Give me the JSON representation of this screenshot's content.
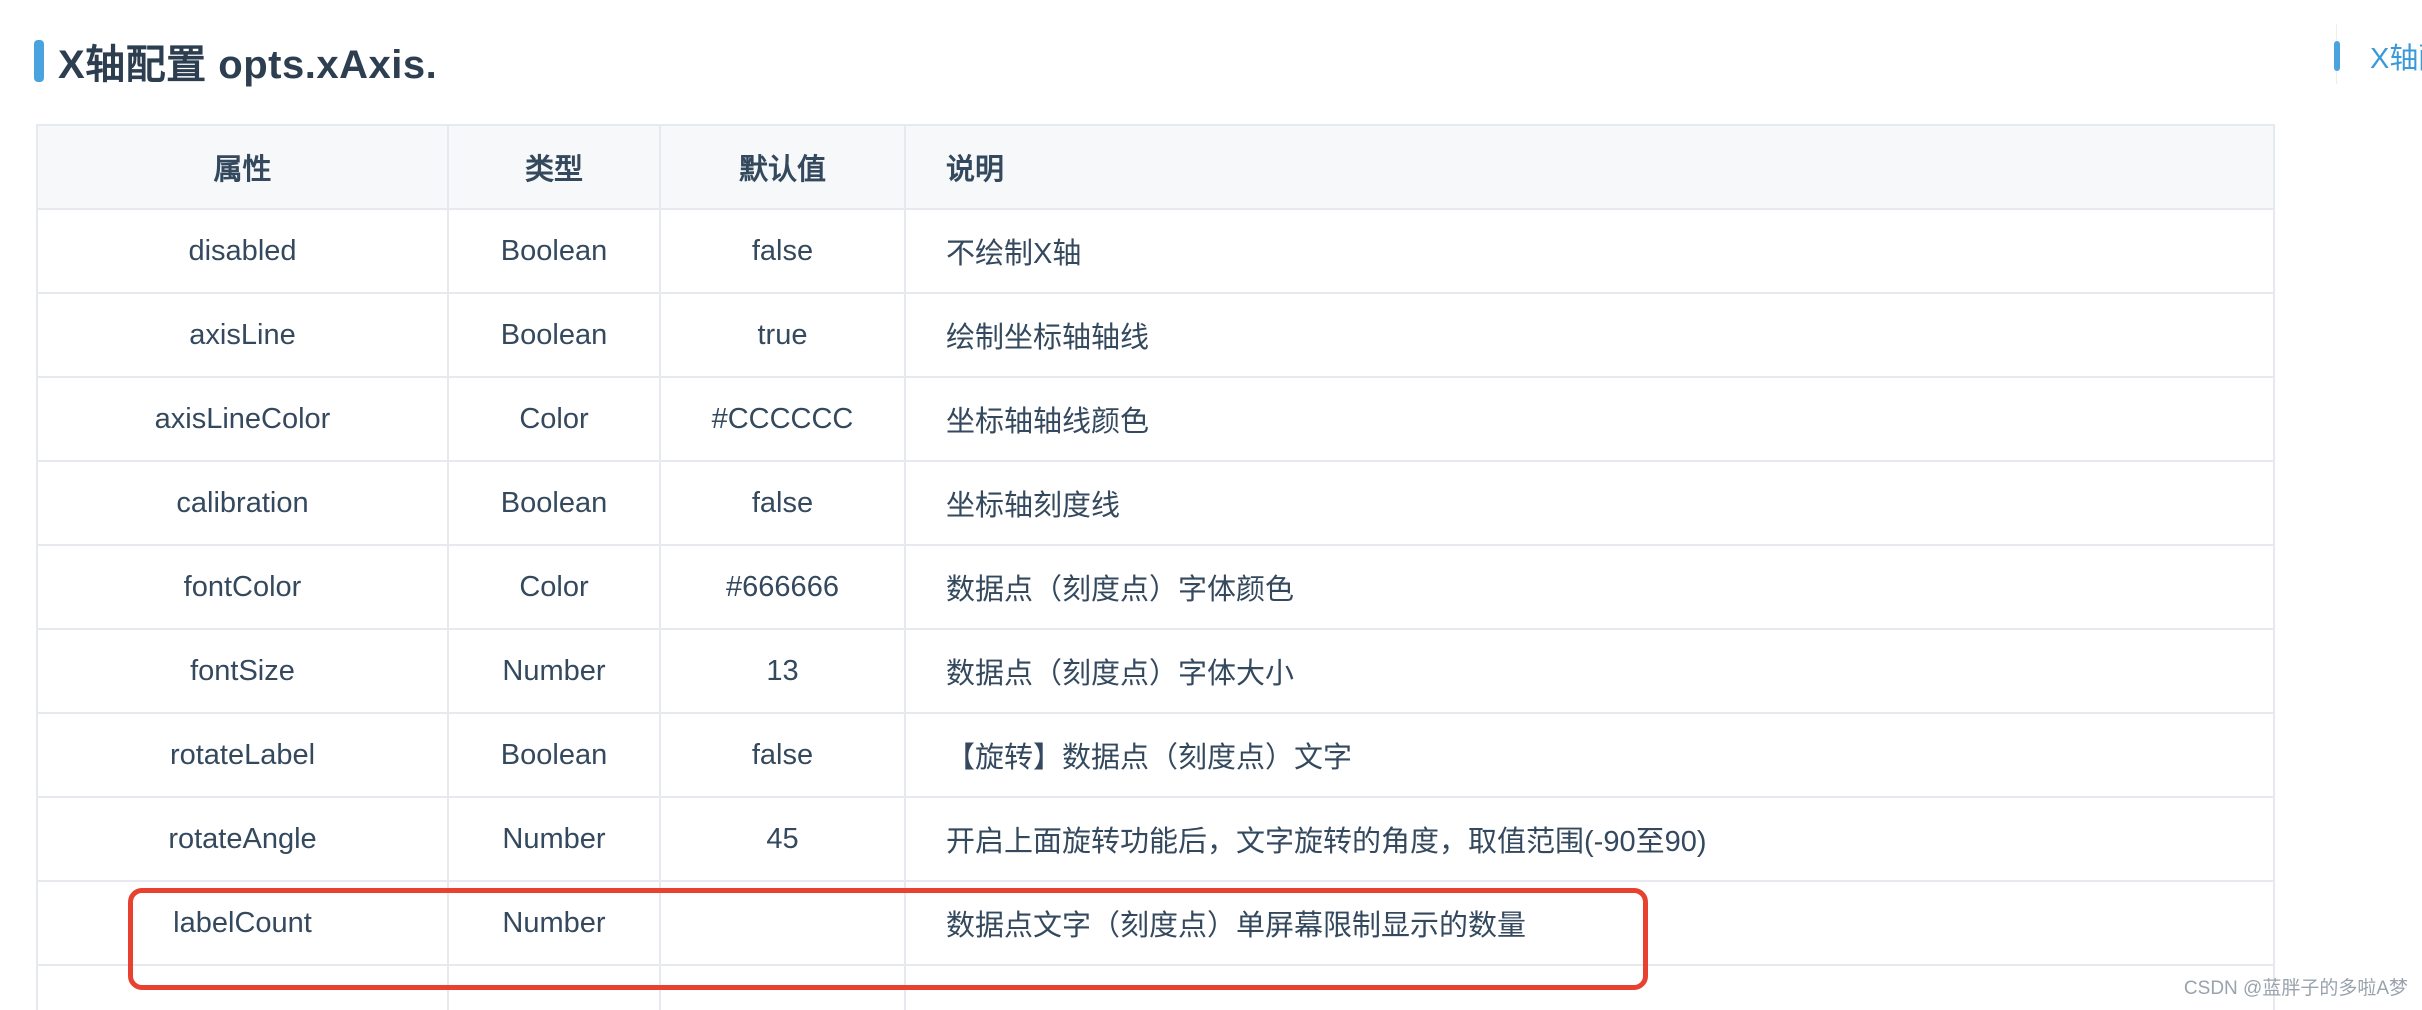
{
  "section": {
    "title": "X轴配置 opts.xAxis."
  },
  "toc": {
    "link_label": "X轴配置"
  },
  "table": {
    "headers": [
      "属性",
      "类型",
      "默认值",
      "说明"
    ],
    "rows": [
      [
        "disabled",
        "Boolean",
        "false",
        "不绘制X轴"
      ],
      [
        "axisLine",
        "Boolean",
        "true",
        "绘制坐标轴轴线"
      ],
      [
        "axisLineColor",
        "Color",
        "#CCCCCC",
        "坐标轴轴线颜色"
      ],
      [
        "calibration",
        "Boolean",
        "false",
        "坐标轴刻度线"
      ],
      [
        "fontColor",
        "Color",
        "#666666",
        "数据点（刻度点）字体颜色"
      ],
      [
        "fontSize",
        "Number",
        "13",
        "数据点（刻度点）字体大小"
      ],
      [
        "rotateLabel",
        "Boolean",
        "false",
        "【旋转】数据点（刻度点）文字"
      ],
      [
        "rotateAngle",
        "Number",
        "45",
        "开启上面旋转功能后，文字旋转的角度，取值范围(-90至90)"
      ],
      [
        "labelCount",
        "Number",
        "",
        "数据点文字（刻度点）单屏幕限制显示的数量"
      ],
      [
        "",
        "",
        "",
        ""
      ]
    ],
    "highlighted_row": "labelCount"
  },
  "watermark": {
    "text": "CSDN @蓝胖子的多啦A梦"
  },
  "colors": {
    "accent": "#4aa3df",
    "highlight": "#e8412f",
    "header_bg": "#f6f8fa",
    "border": "#e6e9ed"
  }
}
